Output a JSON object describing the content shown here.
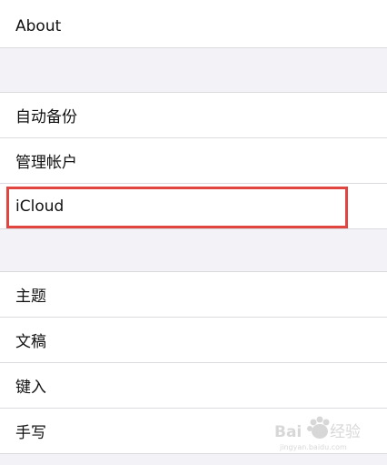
{
  "settings": {
    "section1": [
      {
        "label": "About"
      }
    ],
    "section2": [
      {
        "label": "自动备份"
      },
      {
        "label": "管理帐户"
      },
      {
        "label": "iCloud"
      }
    ],
    "section3": [
      {
        "label": "主题"
      },
      {
        "label": "文稿"
      },
      {
        "label": "键入"
      },
      {
        "label": "手写"
      }
    ]
  },
  "overlay": {
    "highlight_color": "#e0453f",
    "watermark_text": "Baidu经验",
    "watermark_subtext": "jingyan.baidu.com"
  }
}
